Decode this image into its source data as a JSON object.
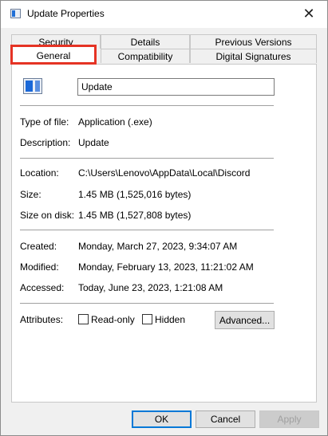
{
  "window": {
    "title": "Update Properties",
    "close_glyph": "✕"
  },
  "tabs": {
    "back_row": [
      "Security",
      "Details",
      "Previous Versions"
    ],
    "front_row": [
      "General",
      "Compatibility",
      "Digital Signatures"
    ],
    "selected": "General"
  },
  "general": {
    "file_name": "Update",
    "type_label": "Type of file:",
    "type_value": "Application (.exe)",
    "description_label": "Description:",
    "description_value": "Update",
    "location_label": "Location:",
    "location_value": "C:\\Users\\Lenovo\\AppData\\Local\\Discord",
    "size_label": "Size:",
    "size_value": "1.45 MB (1,525,016 bytes)",
    "size_on_disk_label": "Size on disk:",
    "size_on_disk_value": "1.45 MB (1,527,808 bytes)",
    "created_label": "Created:",
    "created_value": "Monday, March 27, 2023, 9:34:07 AM",
    "modified_label": "Modified:",
    "modified_value": "Monday, February 13, 2023, 11:21:02 AM",
    "accessed_label": "Accessed:",
    "accessed_value": "Today, June 23, 2023, 1:21:08 AM",
    "attributes_label": "Attributes:",
    "readonly_label": "Read-only",
    "hidden_label": "Hidden",
    "advanced_label": "Advanced..."
  },
  "footer": {
    "ok_label": "OK",
    "cancel_label": "Cancel",
    "apply_label": "Apply"
  },
  "colors": {
    "highlight": "#e53324",
    "accent": "#0078d7"
  },
  "icons": {
    "app": "application-exe-icon",
    "close": "close-icon"
  }
}
